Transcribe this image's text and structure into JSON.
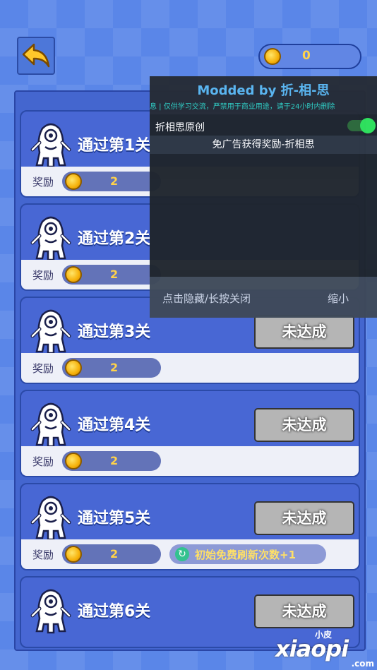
{
  "header": {
    "coins": "0"
  },
  "missions": [
    {
      "title": "通过第1关",
      "reward_label": "奖励",
      "reward_amount": "2"
    },
    {
      "title": "通过第2关",
      "reward_label": "奖励",
      "reward_amount": "2"
    },
    {
      "title": "通过第3关",
      "status": "未达成",
      "reward_label": "奖励",
      "reward_amount": "2"
    },
    {
      "title": "通过第4关",
      "status": "未达成",
      "reward_label": "奖励",
      "reward_amount": "2"
    },
    {
      "title": "通过第5关",
      "status": "未达成",
      "reward_label": "奖励",
      "reward_amount": "2",
      "bonus": "初始免费刷新次数+1"
    },
    {
      "title": "通过第6关",
      "status": "未达成"
    }
  ],
  "mod_menu": {
    "title": "Modded by 折-相-思",
    "notice": "息 | 仅供学习交流，严禁用于商业用途，请于24小时内删除",
    "toggle_label": "折相思原创",
    "toggle_on": true,
    "action_label": "免广告获得奖励-折相思",
    "hide_label": "点击隐藏/长按关闭",
    "minimize_label": "缩小"
  },
  "watermark": {
    "small": "小皮",
    "big": "xiaopi",
    "domain": ".com"
  },
  "colors": {
    "accent": "#5bb8f2",
    "toggle": "#2fe35b",
    "coin": "#ffd24a",
    "status_bg": "#b5b5b5"
  }
}
